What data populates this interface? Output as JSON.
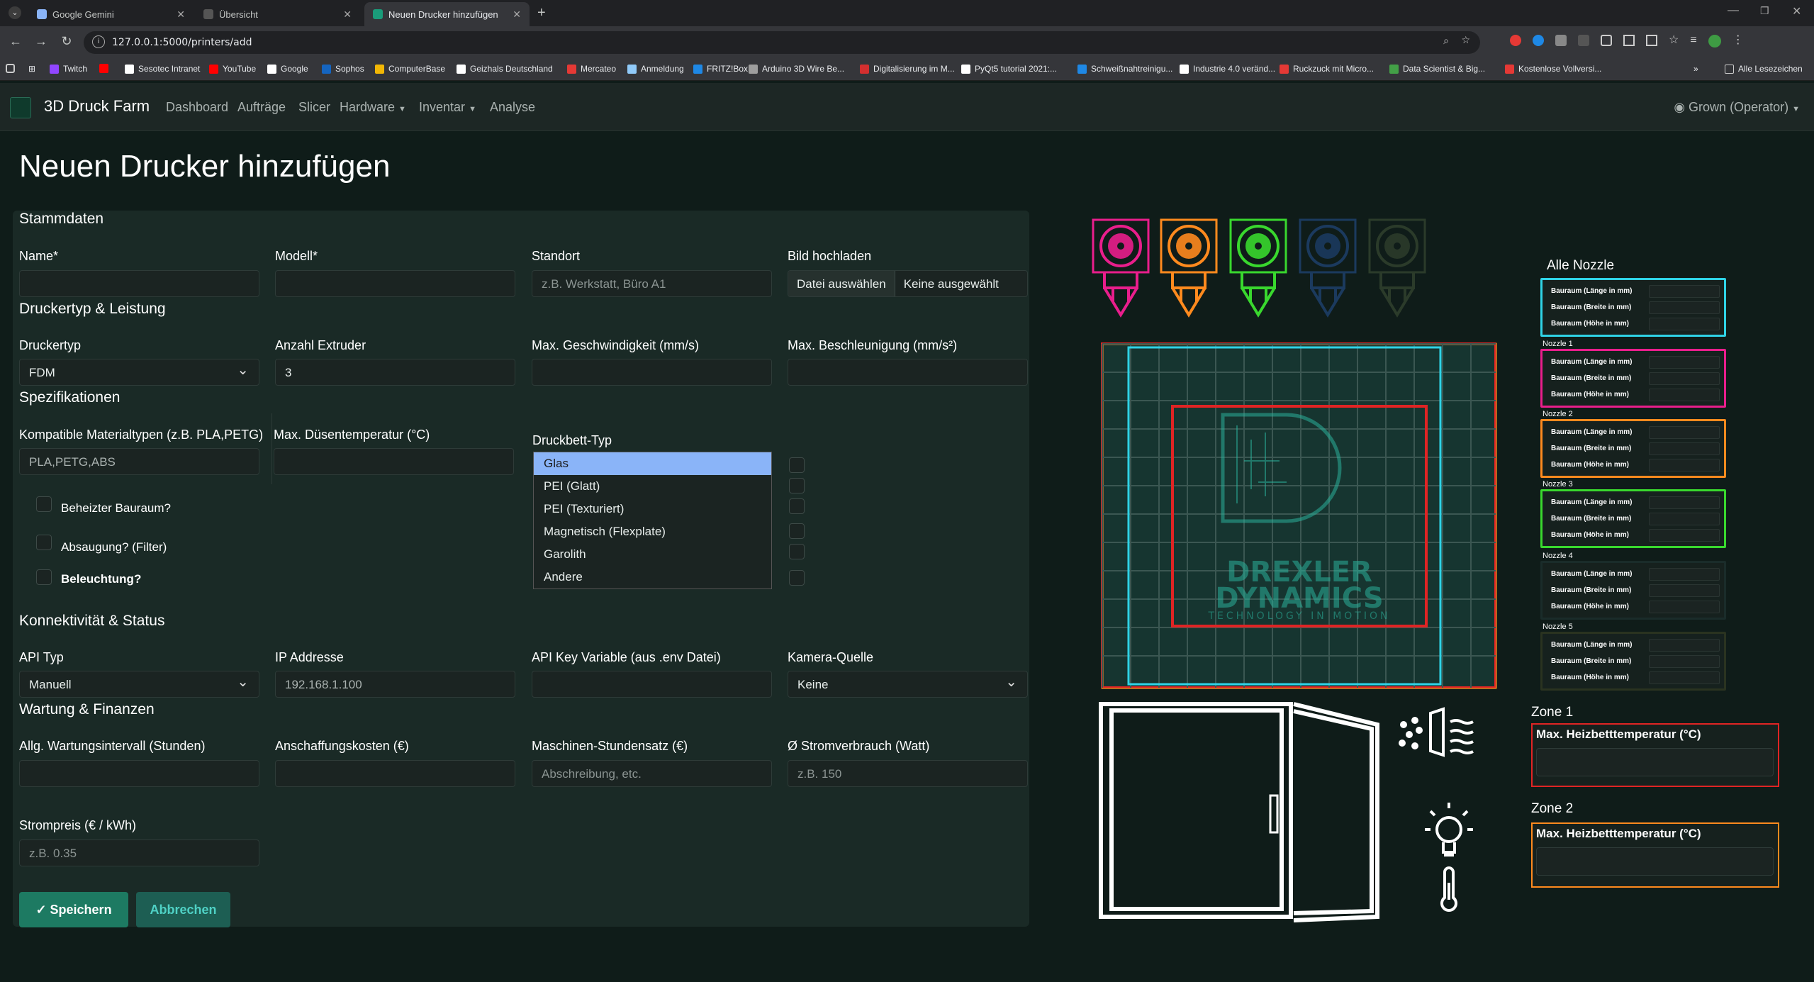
{
  "browser": {
    "tabs": [
      {
        "title": "Google Gemini",
        "color": "#8ab4f8"
      },
      {
        "title": "Übersicht",
        "color": "#555"
      },
      {
        "title": "Neuen Drucker hinzufügen",
        "color": "#1a9c7a"
      }
    ],
    "url": "127.0.0.1:5000/printers/add",
    "bookmarks": [
      {
        "label": "Twitch",
        "color": "#9146ff"
      },
      {
        "label": "",
        "color": "#ff0000"
      },
      {
        "label": "Sesotec Intranet",
        "color": "#ffffff"
      },
      {
        "label": "YouTube",
        "color": "#ff0000"
      },
      {
        "label": "Google",
        "color": "#ffffff"
      },
      {
        "label": "Sophos",
        "color": "#1565c0"
      },
      {
        "label": "ComputerBase",
        "color": "#f2b705"
      },
      {
        "label": "Geizhals Deutschland",
        "color": "#ffffff"
      },
      {
        "label": "Mercateo",
        "color": "#e53935"
      },
      {
        "label": "Anmeldung",
        "color": "#90caf9"
      },
      {
        "label": "FRITZ!Box",
        "color": "#1e88e5"
      },
      {
        "label": "Arduino 3D Wire Be...",
        "color": "#9e9e9e"
      },
      {
        "label": "Digitalisierung im M...",
        "color": "#d32f2f"
      },
      {
        "label": "PyQt5 tutorial 2021:...",
        "color": "#ffffff"
      },
      {
        "label": "Schweißnahtreinigu...",
        "color": "#1e88e5"
      },
      {
        "label": "Industrie 4.0 veränd...",
        "color": "#ffffff"
      },
      {
        "label": "Ruckzuck mit Micro...",
        "color": "#e53935"
      },
      {
        "label": "Data Scientist & Big...",
        "color": "#43a047"
      },
      {
        "label": "Kostenlose Vollversi...",
        "color": "#e53935"
      }
    ],
    "more": "»",
    "all_bookmarks": "Alle Lesezeichen"
  },
  "nav": {
    "brand": "3D Druck Farm",
    "links": [
      "Dashboard",
      "Aufträge",
      "Slicer",
      "Hardware",
      "Inventar",
      "Analyse"
    ],
    "dropdown_links": {
      "Hardware": true,
      "Inventar": true
    },
    "user": "Grown (Operator)"
  },
  "page": {
    "title": "Neuen Drucker hinzufügen"
  },
  "form": {
    "stammdaten": {
      "heading": "Stammdaten",
      "name_label": "Name*",
      "name_value": "",
      "modell_label": "Modell*",
      "modell_value": "",
      "standort_label": "Standort",
      "standort_placeholder": "z.B. Werkstatt, Büro A1",
      "bild_label": "Bild hochladen",
      "bild_button": "Datei auswählen",
      "bild_status": "Keine ausgewählt"
    },
    "druckertyp": {
      "heading": "Druckertyp & Leistung",
      "typ_label": "Druckertyp",
      "typ_value": "FDM",
      "extruder_label": "Anzahl Extruder",
      "extruder_value": "3",
      "geschw_label": "Max. Geschwindigkeit (mm/s)",
      "beschl_label": "Max. Beschleunigung (mm/s²)"
    },
    "spezifikationen": {
      "heading": "Spezifikationen",
      "material_label": "Kompatible Materialtypen (z.B. PLA,PETG)",
      "material_value": "PLA,PETG,ABS",
      "duesentemp_label": "Max. Düsentemperatur (°C)",
      "druckbett_label": "Druckbett-Typ",
      "druckbett_options": [
        "Glas",
        "PEI (Glatt)",
        "PEI (Texturiert)",
        "Magnetisch (Flexplate)",
        "Garolith",
        "Andere"
      ],
      "druckbett_highlighted": "Glas",
      "beheizt_label": "Beheizter Bauraum?",
      "absaugung_label": "Absaugung? (Filter)",
      "beleuchtung_label": "Beleuchtung?"
    },
    "konnektivitaet": {
      "heading": "Konnektivität & Status",
      "api_label": "API Typ",
      "api_value": "Manuell",
      "ip_label": "IP Addresse",
      "ip_placeholder": "192.168.1.100",
      "apikey_label": "API Key Variable (aus .env Datei)",
      "kamera_label": "Kamera-Quelle",
      "kamera_value": "Keine"
    },
    "wartung": {
      "heading": "Wartung & Finanzen",
      "intervall_label": "Allg. Wartungsintervall (Stunden)",
      "kosten_label": "Anschaffungskosten (€)",
      "stundensatz_label": "Maschinen-Stundensatz (€)",
      "stundensatz_placeholder": "Abschreibung, etc.",
      "strom_label": "Ø Stromverbrauch (Watt)",
      "strom_placeholder": "z.B. 150",
      "strompreis_label": "Strompreis (€ / kWh)",
      "strompreis_placeholder": "z.B. 0.35"
    },
    "save_label": "Speichern",
    "cancel_label": "Abbrechen"
  },
  "preview": {
    "nozzle_colors": [
      "#e91e8c",
      "#ff8a1e",
      "#39d82e",
      "#1b3a5e",
      "#2b3b2a"
    ],
    "logo_line1": "DREXLER",
    "logo_line2": "DYNAMICS",
    "logo_tagline": "TECHNOLOGY IN MOTION",
    "nozzles_title": "Alle Nozzle",
    "nozzles": [
      {
        "caption": "",
        "color": "#2fd3e6",
        "rows": [
          "Bauraum (Länge in mm)",
          "Bauraum (Breite in mm)",
          "Bauraum (Höhe in mm)"
        ]
      },
      {
        "caption": "Nozzle 1",
        "color": "#e91e8c",
        "rows": [
          "Bauraum (Länge in mm)",
          "Bauraum (Breite in mm)",
          "Bauraum (Höhe in mm)"
        ]
      },
      {
        "caption": "Nozzle 2",
        "color": "#ff8a1e",
        "rows": [
          "Bauraum (Länge in mm)",
          "Bauraum (Breite in mm)",
          "Bauraum (Höhe in mm)"
        ]
      },
      {
        "caption": "Nozzle 3",
        "color": "#39d82e",
        "rows": [
          "Bauraum (Länge in mm)",
          "Bauraum (Breite in mm)",
          "Bauraum (Höhe in mm)"
        ]
      },
      {
        "caption": "Nozzle 4",
        "color": "#1a2c2a",
        "rows": [
          "Bauraum (Länge in mm)",
          "Bauraum (Breite in mm)",
          "Bauraum (Höhe in mm)"
        ]
      },
      {
        "caption": "Nozzle 5",
        "color": "#2a3320",
        "rows": [
          "Bauraum (Länge in mm)",
          "Bauraum (Breite in mm)",
          "Bauraum (Höhe in mm)"
        ]
      }
    ],
    "zones": [
      {
        "title": "Zone 1",
        "label": "Max. Heizbetttemperatur (°C)",
        "color": "#e02424"
      },
      {
        "title": "Zone 2",
        "label": "Max. Heizbetttemperatur (°C)",
        "color": "#ff8a1e"
      }
    ]
  }
}
